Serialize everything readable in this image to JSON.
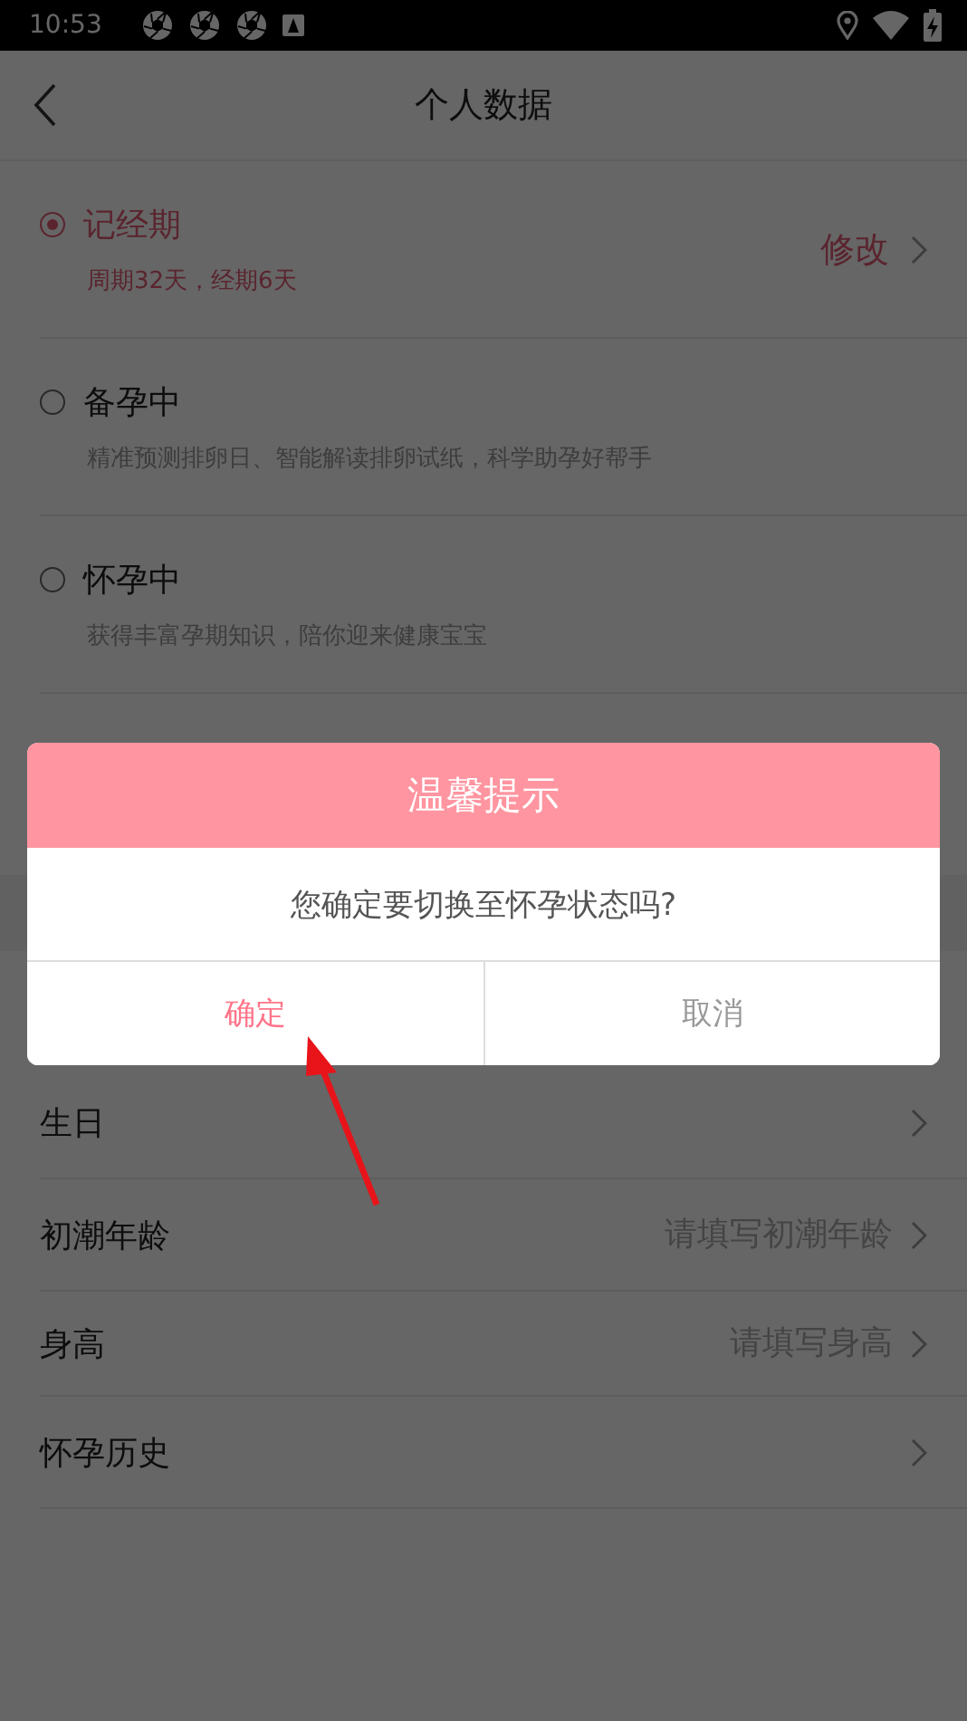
{
  "status_bar": {
    "time": "10:53"
  },
  "header": {
    "title": "个人数据"
  },
  "modes": [
    {
      "label": "记经期",
      "description": "周期32天，经期6天",
      "action": "修改",
      "selected": true
    },
    {
      "label": "备孕中",
      "description": "精准预测排卵日、智能解读排卵试纸，科学助孕好帮手",
      "selected": false
    },
    {
      "label": "怀孕中",
      "description": "获得丰富孕期知识，陪你迎来健康宝宝",
      "selected": false
    }
  ],
  "fields": [
    {
      "label": "生日"
    },
    {
      "label": "初潮年龄",
      "placeholder": "请填写初潮年龄"
    },
    {
      "label": "身高",
      "placeholder": "请填写身高"
    },
    {
      "label": "怀孕历史"
    }
  ],
  "dialog": {
    "title": "温馨提示",
    "message": "您确定要切换至怀孕状态吗?",
    "buttons": [
      {
        "label": "确定",
        "kind": "confirm"
      },
      {
        "label": "取消",
        "kind": "cancel"
      }
    ]
  }
}
